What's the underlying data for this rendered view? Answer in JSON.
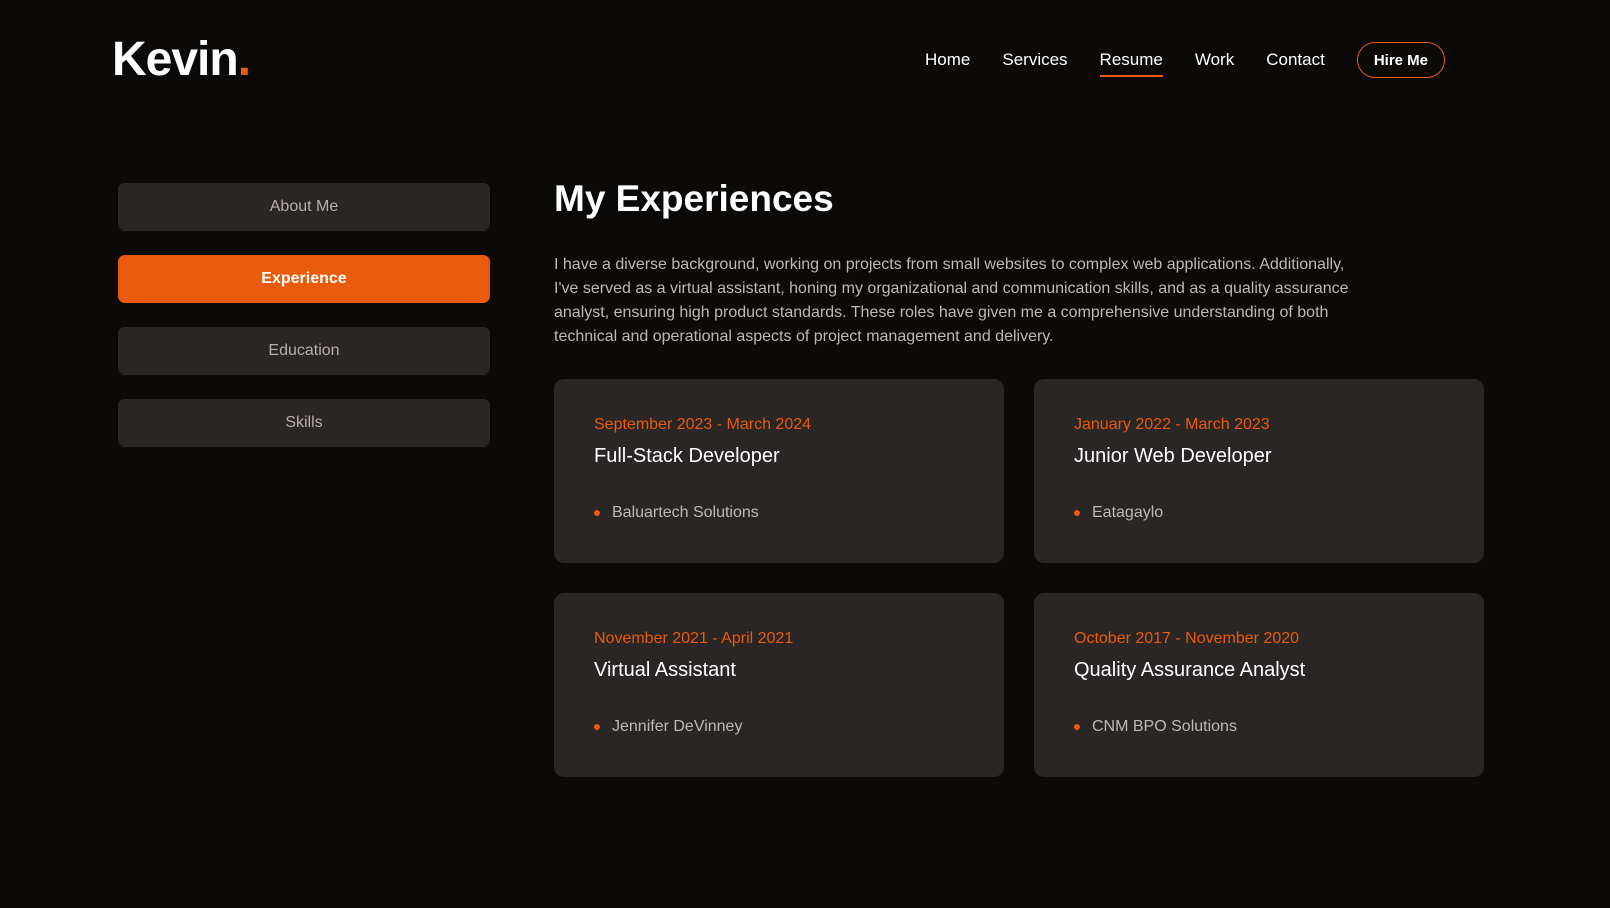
{
  "brand": {
    "name": "Kevin",
    "dot": ".",
    "accent_color": "#ea5a0c"
  },
  "nav": {
    "items": [
      {
        "label": "Home"
      },
      {
        "label": "Services"
      },
      {
        "label": "Resume",
        "active": true
      },
      {
        "label": "Work"
      },
      {
        "label": "Contact"
      }
    ],
    "hire_label": "Hire Me"
  },
  "sidebar": {
    "items": [
      {
        "label": "About Me"
      },
      {
        "label": "Experience",
        "active": true
      },
      {
        "label": "Education"
      },
      {
        "label": "Skills"
      }
    ]
  },
  "main": {
    "title": "My Experiences",
    "intro": "I have a diverse background, working on projects from small websites to complex web applications. Additionally, I've served as a virtual assistant, honing my organizational and communication skills, and as a quality assurance analyst, ensuring high product standards. These roles have given me a comprehensive understanding of both technical and operational aspects of project management and delivery.",
    "experiences": [
      {
        "date": "September 2023 - March 2024",
        "role": "Full-Stack Developer",
        "company": "Baluartech Solutions"
      },
      {
        "date": "January 2022 - March 2023",
        "role": "Junior Web Developer",
        "company": "Eatagaylo"
      },
      {
        "date": "November 2021 - April 2021",
        "role": "Virtual Assistant",
        "company": "Jennifer DeVinney"
      },
      {
        "date": "October 2017 - November 2020",
        "role": "Quality Assurance Analyst",
        "company": "CNM BPO Solutions"
      }
    ]
  }
}
